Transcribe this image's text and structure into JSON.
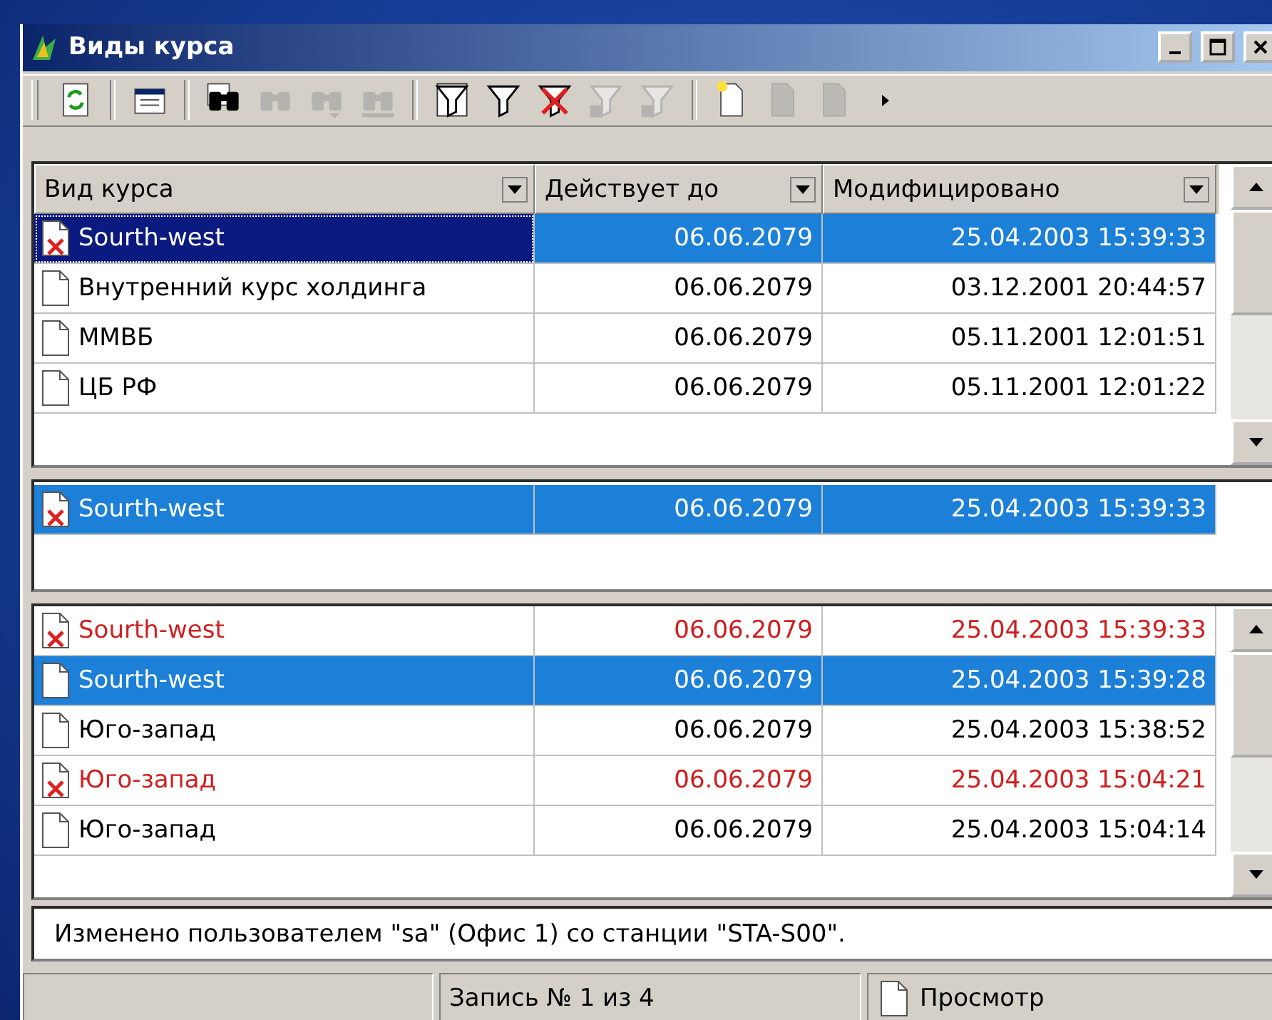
{
  "window": {
    "title": "Виды курса"
  },
  "toolbar": [
    {
      "kind": "refresh",
      "disabled": false
    },
    {
      "kind": "sep"
    },
    {
      "kind": "properties",
      "disabled": false
    },
    {
      "kind": "sep"
    },
    {
      "kind": "find",
      "disabled": false
    },
    {
      "kind": "binoculars",
      "disabled": true
    },
    {
      "kind": "binoculars-down",
      "disabled": true
    },
    {
      "kind": "binoculars-bar",
      "disabled": true
    },
    {
      "kind": "sep"
    },
    {
      "kind": "filter-list",
      "disabled": false
    },
    {
      "kind": "filter",
      "disabled": false
    },
    {
      "kind": "filter-clear",
      "disabled": false
    },
    {
      "kind": "filter-doc",
      "disabled": true
    },
    {
      "kind": "filter-doc",
      "disabled": true
    },
    {
      "kind": "sep"
    },
    {
      "kind": "new",
      "disabled": false
    },
    {
      "kind": "edit",
      "disabled": true
    },
    {
      "kind": "delete",
      "disabled": true
    },
    {
      "kind": "more",
      "disabled": false
    }
  ],
  "table": {
    "columns": [
      "Вид курса",
      "Действует до",
      "Модифицировано"
    ],
    "rows": [
      {
        "name": "Sourth-west",
        "valid_until": "06.06.2079",
        "modified": "25.04.2003 15:39:33",
        "deleted": true,
        "selected": true,
        "focused": true
      },
      {
        "name": "Внутренний курс холдинга",
        "valid_until": "06.06.2079",
        "modified": "03.12.2001 20:44:57",
        "deleted": false,
        "selected": false,
        "focused": false
      },
      {
        "name": "ММВБ",
        "valid_until": "06.06.2079",
        "modified": "05.11.2001 12:01:51",
        "deleted": false,
        "selected": false,
        "focused": false
      },
      {
        "name": "ЦБ РФ",
        "valid_until": "06.06.2079",
        "modified": "05.11.2001 12:01:22",
        "deleted": false,
        "selected": false,
        "focused": false
      }
    ]
  },
  "current": {
    "rows": [
      {
        "name": "Sourth-west",
        "valid_until": "06.06.2079",
        "modified": "25.04.2003 15:39:33",
        "deleted": true,
        "selected": true,
        "focused": false
      }
    ]
  },
  "history": {
    "rows": [
      {
        "name": "Sourth-west",
        "valid_until": "06.06.2079",
        "modified": "25.04.2003 15:39:33",
        "deleted": true,
        "selected": false,
        "focused": false
      },
      {
        "name": "Sourth-west",
        "valid_until": "06.06.2079",
        "modified": "25.04.2003 15:39:28",
        "deleted": false,
        "selected": true,
        "focused": false
      },
      {
        "name": "Юго-запад",
        "valid_until": "06.06.2079",
        "modified": "25.04.2003 15:38:52",
        "deleted": false,
        "selected": false,
        "focused": false
      },
      {
        "name": "Юго-запад",
        "valid_until": "06.06.2079",
        "modified": "25.04.2003 15:04:21",
        "deleted": true,
        "selected": false,
        "focused": false
      },
      {
        "name": "Юго-запад",
        "valid_until": "06.06.2079",
        "modified": "25.04.2003 15:04:14",
        "deleted": false,
        "selected": false,
        "focused": false
      }
    ]
  },
  "info": "Изменено пользователем \"sa\" (Офис 1) со станции \"STA-S00\".",
  "status_bar": {
    "record": "Запись № 1 из 4",
    "mode": "Просмотр"
  }
}
